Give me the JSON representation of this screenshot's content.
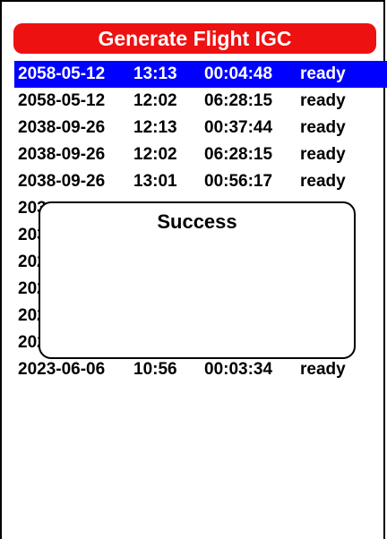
{
  "header": {
    "title": "Generate Flight IGC"
  },
  "flights": [
    {
      "date": "2058-05-12",
      "time": "13:13",
      "duration": "00:04:48",
      "status": "ready",
      "selected": true
    },
    {
      "date": "2058-05-12",
      "time": "12:02",
      "duration": "06:28:15",
      "status": "ready"
    },
    {
      "date": "2038-09-26",
      "time": "12:13",
      "duration": "00:37:44",
      "status": "ready"
    },
    {
      "date": "2038-09-26",
      "time": "12:02",
      "duration": "06:28:15",
      "status": "ready"
    },
    {
      "date": "2038-09-26",
      "time": "13:01",
      "duration": "00:56:17",
      "status": "ready"
    },
    {
      "date": "203",
      "time": "",
      "duration": "",
      "status": ""
    },
    {
      "date": "203",
      "time": "",
      "duration": "",
      "status": ""
    },
    {
      "date": "202",
      "time": "",
      "duration": "",
      "status": ""
    },
    {
      "date": "202",
      "time": "",
      "duration": "",
      "status": ""
    },
    {
      "date": "202",
      "time": "",
      "duration": "",
      "status": ""
    },
    {
      "date": "202",
      "time": "",
      "duration": "",
      "status": ""
    },
    {
      "date": "2023-06-06",
      "time": "10:56",
      "duration": "00:03:34",
      "status": "ready"
    }
  ],
  "dialog": {
    "message": "Success"
  },
  "colors": {
    "title_bg": "#ee1111",
    "selection": "#0000ff"
  }
}
